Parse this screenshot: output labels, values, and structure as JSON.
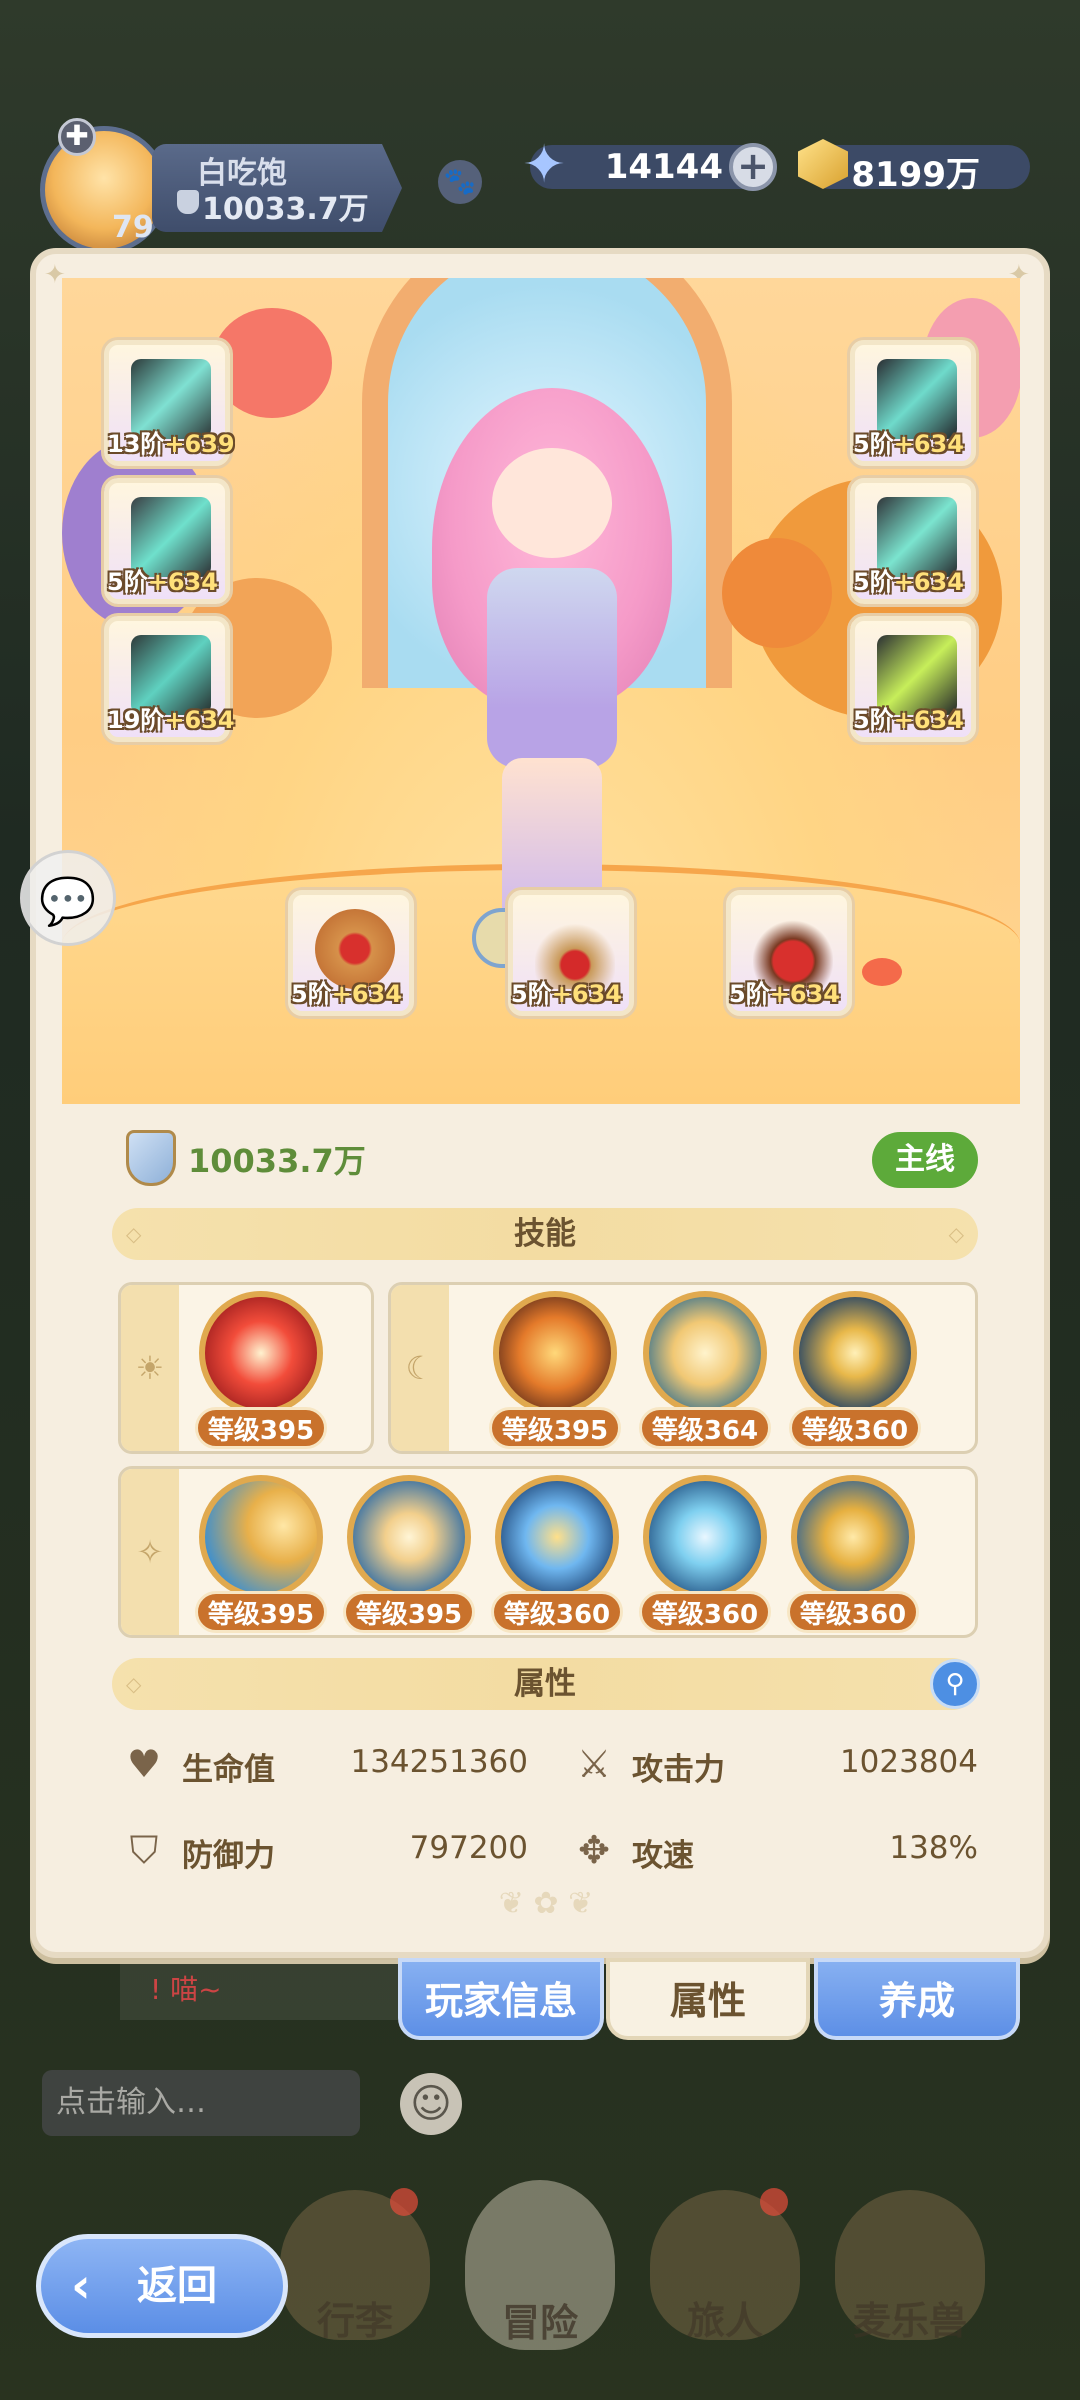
{
  "profile": {
    "name": "白吃饱",
    "power": "10033.7万",
    "level": "79"
  },
  "currencies": {
    "gems": "14144",
    "gold": "8199万"
  },
  "equipment": [
    {
      "slot": "weapon",
      "tier": "13阶",
      "bonus": "+639"
    },
    {
      "slot": "helmet",
      "tier": "5阶",
      "bonus": "+634"
    },
    {
      "slot": "armor",
      "tier": "5阶",
      "bonus": "+634"
    },
    {
      "slot": "gloves",
      "tier": "5阶",
      "bonus": "+634"
    },
    {
      "slot": "belt",
      "tier": "19阶",
      "bonus": "+634"
    },
    {
      "slot": "boots",
      "tier": "5阶",
      "bonus": "+634"
    },
    {
      "slot": "ring",
      "tier": "5阶",
      "bonus": "+634"
    },
    {
      "slot": "necklace",
      "tier": "5阶",
      "bonus": "+634"
    },
    {
      "slot": "amulet",
      "tier": "5阶",
      "bonus": "+634"
    }
  ],
  "panel": {
    "power": "10033.7万",
    "mainline_label": "主线",
    "skills_title": "技能",
    "attrs_title": "属性"
  },
  "skills": {
    "sun": [
      {
        "level": "等级395"
      }
    ],
    "moon": [
      {
        "level": "等级395"
      },
      {
        "level": "等级364"
      },
      {
        "level": "等级360"
      }
    ],
    "star": [
      {
        "level": "等级395"
      },
      {
        "level": "等级395"
      },
      {
        "level": "等级360"
      },
      {
        "level": "等级360"
      },
      {
        "level": "等级360"
      }
    ]
  },
  "attributes": {
    "hp_label": "生命值",
    "hp_value": "134251360",
    "atk_label": "攻击力",
    "atk_value": "1023804",
    "def_label": "防御力",
    "def_value": "797200",
    "spd_label": "攻速",
    "spd_value": "138%"
  },
  "tabs": {
    "player_info": "玩家信息",
    "attributes": "属性",
    "training": "养成"
  },
  "chat": {
    "input_placeholder": "点击输入…",
    "message": "! 喵~"
  },
  "bottom_nav": {
    "items": [
      "行李",
      "冒险",
      "旅人",
      "麦乐兽"
    ],
    "back": "返回"
  }
}
